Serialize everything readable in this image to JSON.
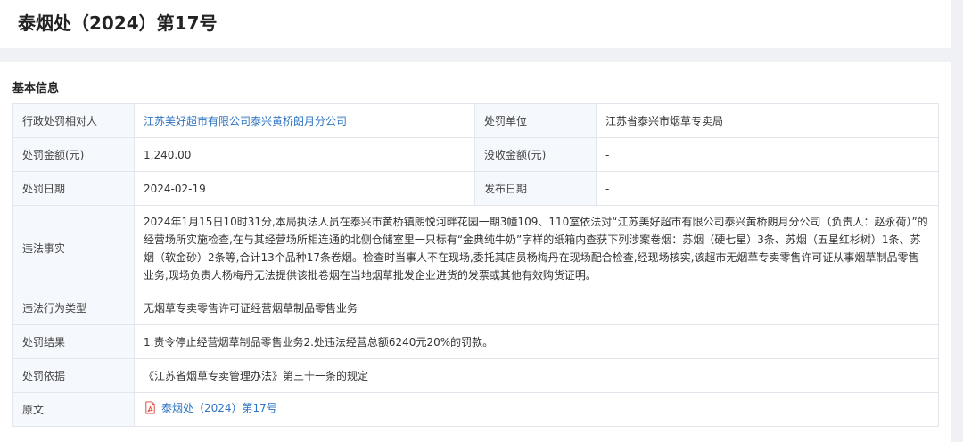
{
  "title": "泰烟处（2024）第17号",
  "section_title": "基本信息",
  "rows": {
    "party_label": "行政处罚相对人",
    "party_value": "江苏美好超市有限公司泰兴黄桥朗月分公司",
    "unit_label": "处罚单位",
    "unit_value": "江苏省泰兴市烟草专卖局",
    "fine_label": "处罚金额(元)",
    "fine_value": "1,240.00",
    "confiscate_label": "没收金额(元)",
    "confiscate_value": "-",
    "date_label": "处罚日期",
    "date_value": "2024-02-19",
    "publish_label": "发布日期",
    "publish_value": "-",
    "facts_label": "违法事实",
    "facts_value": "2024年1月15日10时31分,本局执法人员在泰兴市黄桥镇朗悦河畔花园一期3幢109、110室依法对“江苏美好超市有限公司泰兴黄桥朗月分公司（负责人：赵永荷）”的经营场所实施检查,在与其经营场所相连通的北侧仓储室里一只标有“金典纯牛奶”字样的纸箱内查获下列涉案卷烟：苏烟（硬七星）3条、苏烟（五星红杉树）1条、苏烟（软金砂）2条等,合计13个品种17条卷烟。检查时当事人不在现场,委托其店员杨梅丹在现场配合检查,经现场核实,该超市无烟草专卖零售许可证从事烟草制品零售业务,现场负责人杨梅丹无法提供该批卷烟在当地烟草批发企业进货的发票或其他有效购货证明。",
    "type_label": "违法行为类型",
    "type_value": "无烟草专卖零售许可证经营烟草制品零售业务",
    "result_label": "处罚结果",
    "result_value": "1.责令停止经营烟草制品零售业务2.处违法经营总额6240元20%的罚款。",
    "basis_label": "处罚依据",
    "basis_value": "《江苏省烟草专卖管理办法》第三十一条的规定",
    "original_label": "原文",
    "original_value": "泰烟处（2024）第17号"
  },
  "colors": {
    "link": "#2f74c0",
    "label_bg": "#f5f8fc",
    "border": "#e3e6ec",
    "pdf_icon": "#e0413a"
  },
  "icons": {
    "original_file": "pdf-icon"
  }
}
